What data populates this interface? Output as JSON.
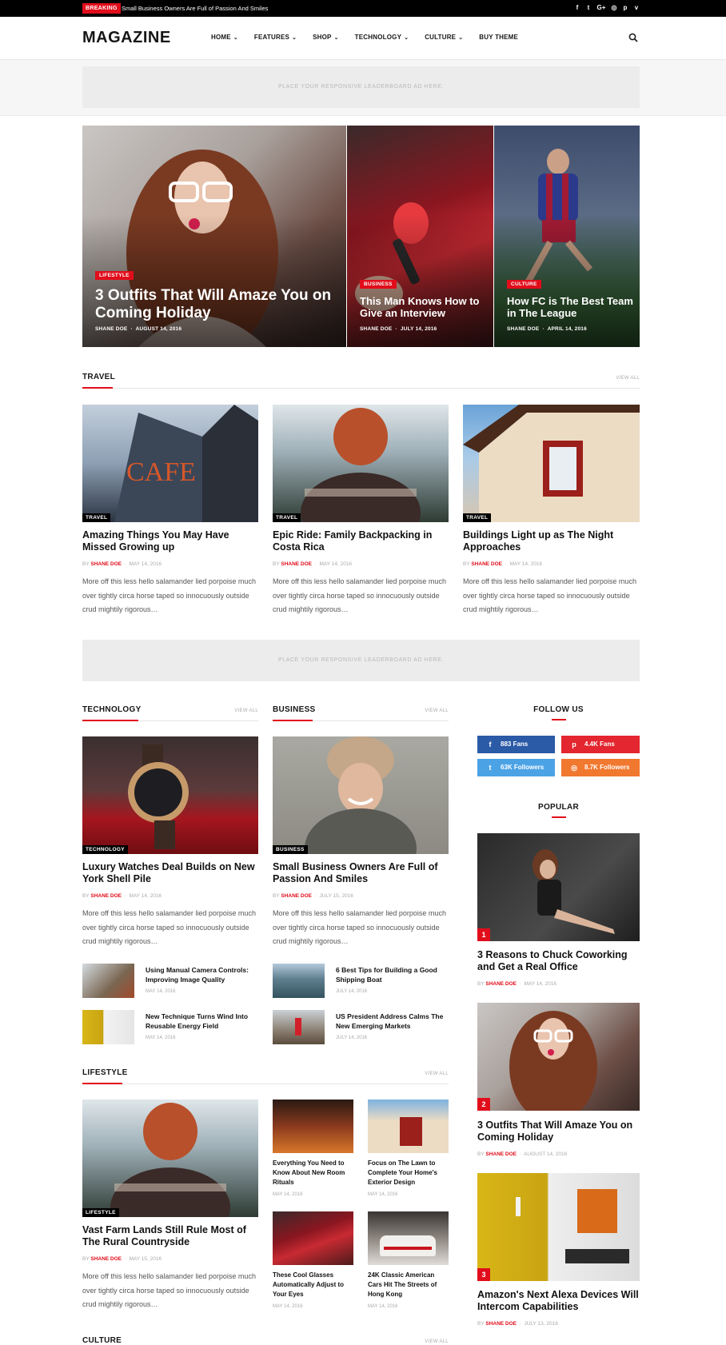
{
  "topbar": {
    "breaking_label": "BREAKING",
    "ticker_text": "Small Business Owners Are Full of Passion And Smiles",
    "social_icons": [
      "facebook-icon",
      "twitter-icon",
      "google-plus-icon",
      "instagram-icon",
      "pinterest-icon",
      "vimeo-icon"
    ],
    "social_glyphs": [
      "f",
      "t",
      "G+",
      "◎",
      "p",
      "v"
    ]
  },
  "header": {
    "logo": "MAGAZINE",
    "nav": [
      {
        "label": "HOME",
        "has_dropdown": true
      },
      {
        "label": "FEATURES",
        "has_dropdown": true
      },
      {
        "label": "SHOP",
        "has_dropdown": true
      },
      {
        "label": "TECHNOLOGY",
        "has_dropdown": true
      },
      {
        "label": "CULTURE",
        "has_dropdown": true
      },
      {
        "label": "BUY THEME",
        "has_dropdown": false
      }
    ],
    "chevron": "⌄",
    "search_icon": "search-icon"
  },
  "ad_text": "PLACE YOUR RESPONSIVE LEADERBOARD AD HERE.",
  "hero": [
    {
      "category": "LIFESTYLE",
      "title": "3 Outfits That Will Amaze You on Coming Holiday",
      "author": "SHANE DOE",
      "date": "AUGUST 14, 2016"
    },
    {
      "category": "BUSINESS",
      "title": "This Man Knows How to Give an Interview",
      "author": "SHANE DOE",
      "date": "JULY 14, 2016"
    },
    {
      "category": "CULTURE",
      "title": "How FC is The Best Team in The League",
      "author": "SHANE DOE",
      "date": "APRIL 14, 2016"
    }
  ],
  "meta_sep": "·",
  "by": "BY",
  "view_all": "VIEW ALL",
  "travel": {
    "heading": "TRAVEL",
    "posts": [
      {
        "tag": "TRAVEL",
        "title": "Amazing Things You May Have Missed Growing up",
        "author": "SHANE DOE",
        "date": "MAY 14, 2016",
        "excerpt": "More off this less hello salamander lied porpoise much over tightly circa horse taped so innocuously outside crud mightily rigorous…"
      },
      {
        "tag": "TRAVEL",
        "title": "Epic Ride: Family Backpacking in Costa Rica",
        "author": "SHANE DOE",
        "date": "MAY 14, 2016",
        "excerpt": "More off this less hello salamander lied porpoise much over tightly circa horse taped so innocuously outside crud mightily rigorous…"
      },
      {
        "tag": "TRAVEL",
        "title": "Buildings Light up as The Night Approaches",
        "author": "SHANE DOE",
        "date": "MAY 14, 2016",
        "excerpt": "More off this less hello salamander lied porpoise much over tightly circa horse taped so innocuously outside crud mightily rigorous…"
      }
    ]
  },
  "technology": {
    "heading": "TECHNOLOGY",
    "main": {
      "tag": "TECHNOLOGY",
      "title": "Luxury Watches Deal Builds on New York Shell Pile",
      "author": "SHANE DOE",
      "date": "MAY 14, 2016",
      "excerpt": "More off this less hello salamander lied porpoise much over tightly circa horse taped so innocuously outside crud mightily rigorous…"
    },
    "small": [
      {
        "title": "Using Manual Camera Controls: Improving Image Quality",
        "date": "MAY 14, 2016"
      },
      {
        "title": "New Technique Turns Wind Into Reusable Energy Field",
        "date": "MAY 14, 2016"
      }
    ]
  },
  "business": {
    "heading": "BUSINESS",
    "main": {
      "tag": "BUSINESS",
      "title": "Small Business Owners Are Full of Passion And Smiles",
      "author": "SHANE DOE",
      "date": "JULY 15, 2016",
      "excerpt": "More off this less hello salamander lied porpoise much over tightly circa horse taped so innocuously outside crud mightily rigorous…"
    },
    "small": [
      {
        "title": "6 Best Tips for Building a Good Shipping Boat",
        "date": "JULY 14, 2016"
      },
      {
        "title": "US President Address Calms The New Emerging Markets",
        "date": "JULY 14, 2016"
      }
    ]
  },
  "lifestyle": {
    "heading": "LIFESTYLE",
    "main": {
      "tag": "LIFESTYLE",
      "title": "Vast Farm Lands Still Rule Most of The Rural Countryside",
      "author": "SHANE DOE",
      "date": "MAY 15, 2016",
      "excerpt": "More off this less hello salamander lied porpoise much over tightly circa horse taped so innocuously outside crud mightily rigorous…"
    },
    "grid": [
      {
        "title": "Everything You Need to Know About New Room Rituals",
        "date": "MAY 14, 2016"
      },
      {
        "title": "Focus on The Lawn to Complete Your Home's Exterior Design",
        "date": "MAY 14, 2016"
      },
      {
        "title": "These Cool Glasses Automatically Adjust to Your Eyes",
        "date": "MAY 14, 2016"
      },
      {
        "title": "24K Classic American Cars Hit The Streets of Hong Kong",
        "date": "MAY 14, 2016"
      }
    ]
  },
  "culture_heading": "CULTURE",
  "sidebar": {
    "follow_heading": "FOLLOW US",
    "social": [
      {
        "name": "facebook",
        "icon": "f",
        "label": "883  Fans",
        "color": "#2b5aa6"
      },
      {
        "name": "pinterest",
        "icon": "p",
        "label": "4.4K  Fans",
        "color": "#e3262f"
      },
      {
        "name": "twitter",
        "icon": "t",
        "label": "63K  Followers",
        "color": "#4ba3e6"
      },
      {
        "name": "instagram",
        "icon": "◎",
        "label": "8.7K  Followers",
        "color": "#f1782f"
      }
    ],
    "popular_heading": "POPULAR",
    "popular": [
      {
        "rank": "1",
        "title": "3 Reasons to Chuck Coworking and Get a Real Office",
        "author": "SHANE DOE",
        "date": "MAY 14, 2016"
      },
      {
        "rank": "2",
        "title": "3 Outfits That Will Amaze You on Coming Holiday",
        "author": "SHANE DOE",
        "date": "AUGUST 14, 2016"
      },
      {
        "rank": "3",
        "title": "Amazon's Next Alexa Devices Will Intercom Capabilities",
        "author": "SHANE DOE",
        "date": "JULY 13, 2016"
      }
    ]
  },
  "colors": {
    "accent": "#e10d1b",
    "dark": "#000000"
  }
}
